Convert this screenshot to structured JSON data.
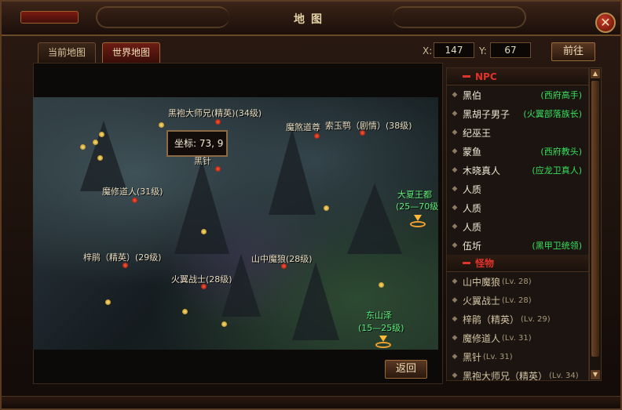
{
  "window": {
    "title": "地图"
  },
  "tabs": [
    {
      "label": "当前地图"
    },
    {
      "label": "世界地图"
    }
  ],
  "coords": {
    "x_label": "X:",
    "x_value": "147",
    "y_label": "Y:",
    "y_value": "67",
    "go_label": "前往"
  },
  "tooltip": {
    "text": "坐标: 73, 9"
  },
  "map_labels": [
    "黑袍大师兄(精英)(34级)",
    "魔煞道尊",
    "索玉鹗（剧情）(38级)",
    "黑针",
    "魔修道人(31级)",
    "梓鹃（精英）(29级)",
    "山中魔狼(28级)",
    "火翼战士(28级)"
  ],
  "portals": [
    {
      "name": "大夏王都",
      "level": "(25—70级)"
    },
    {
      "name": "东山泽",
      "level": "(15—25级)"
    }
  ],
  "back_label": "返回",
  "npc_section": "NPC",
  "npcs": [
    {
      "name": "黑伯",
      "title": "(西府高手)"
    },
    {
      "name": "黑胡子男子",
      "title": "(火翼部落族长)"
    },
    {
      "name": "纪巫王",
      "title": ""
    },
    {
      "name": "蒙鱼",
      "title": "(西府教头)"
    },
    {
      "name": "木晓真人",
      "title": "(应龙卫真人)"
    },
    {
      "name": "人质",
      "title": ""
    },
    {
      "name": "人质",
      "title": ""
    },
    {
      "name": "人质",
      "title": ""
    },
    {
      "name": "伍圻",
      "title": "(黑甲卫统领)"
    }
  ],
  "monster_section": "怪物",
  "monsters": [
    {
      "name": "山中魔狼",
      "lv": "(Lv. 28)"
    },
    {
      "name": "火翼战士",
      "lv": "(Lv. 28)"
    },
    {
      "name": "梓鹃（精英）",
      "lv": "(Lv. 29)"
    },
    {
      "name": "魔修道人",
      "lv": "(Lv. 31)"
    },
    {
      "name": "黑针",
      "lv": "(Lv. 31)"
    },
    {
      "name": "黑袍大师兄（精英）",
      "lv": "(Lv. 34)"
    }
  ]
}
